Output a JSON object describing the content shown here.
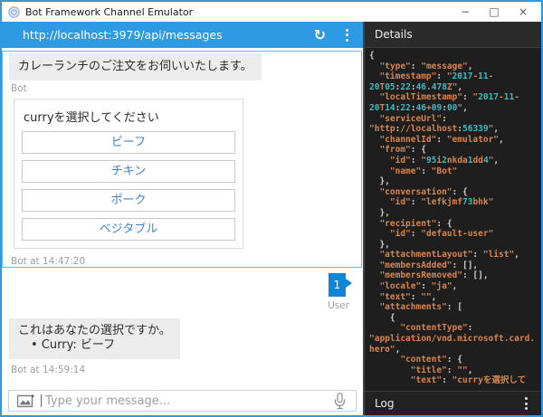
{
  "window": {
    "title": "Bot Framework Channel Emulator"
  },
  "window_controls": {
    "minimize": "−",
    "maximize": "□",
    "close": "×"
  },
  "addressbar": {
    "url": "http://localhost:3979/api/messages",
    "refresh_icon": "↻"
  },
  "chat": {
    "bot_message_1": "カレーランチのご注文をお伺いいたします。",
    "bot_label": "Bot",
    "hero_card": {
      "title": "curryを選択してください",
      "buttons": [
        "ビーフ",
        "チキン",
        "ポーク",
        "ベジタブル"
      ]
    },
    "bot_timestamp_1": "Bot at 14:47:20",
    "user_message": "1",
    "user_label": "User",
    "bot_message_2": "これはあなたの選択ですか。",
    "bot_message_2_bullet": "Curry: ビーフ",
    "bot_timestamp_2": "Bot at 14:59:14"
  },
  "composer": {
    "placeholder": "Type your message..."
  },
  "details": {
    "header": "Details",
    "json_lines": [
      "{",
      "  \"type\": \"message\",",
      "  \"timestamp\": \"2017-11-",
      "20T05:22:46.478Z\",",
      "  \"localTimestamp\": \"2017-11-",
      "20T14:22:46+09:00\",",
      "  \"serviceUrl\":",
      "\"http://localhost:56339\",",
      "  \"channelId\": \"emulator\",",
      "  \"from\": {",
      "    \"id\": \"95i2nkda1dd4\",",
      "    \"name\": \"Bot\"",
      "  },",
      "  \"conversation\": {",
      "    \"id\": \"lefkjmf73bhk\"",
      "  },",
      "  \"recipient\": {",
      "    \"id\": \"default-user\"",
      "  },",
      "  \"attachmentLayout\": \"list\",",
      "  \"membersAdded\": [],",
      "  \"membersRemoved\": [],",
      "  \"locale\": \"ja\",",
      "  \"text\": \"\",",
      "  \"attachments\": [",
      "    {",
      "      \"contentType\":",
      "\"application/vnd.microsoft.card.",
      "hero\",",
      "      \"content\": {",
      "        \"title\": \"\",",
      "        \"text\": \"curryを選択して"
    ]
  },
  "log": {
    "header": "Log"
  },
  "colors": {
    "accent_blue": "#2e9ae4",
    "user_bubble_blue": "#0d86d8",
    "card_button_text": "#4183c4",
    "json_string_orange": "#d8854f",
    "json_number_cyan": "#3fbac2",
    "panel_dark": "#1e1e1e"
  }
}
